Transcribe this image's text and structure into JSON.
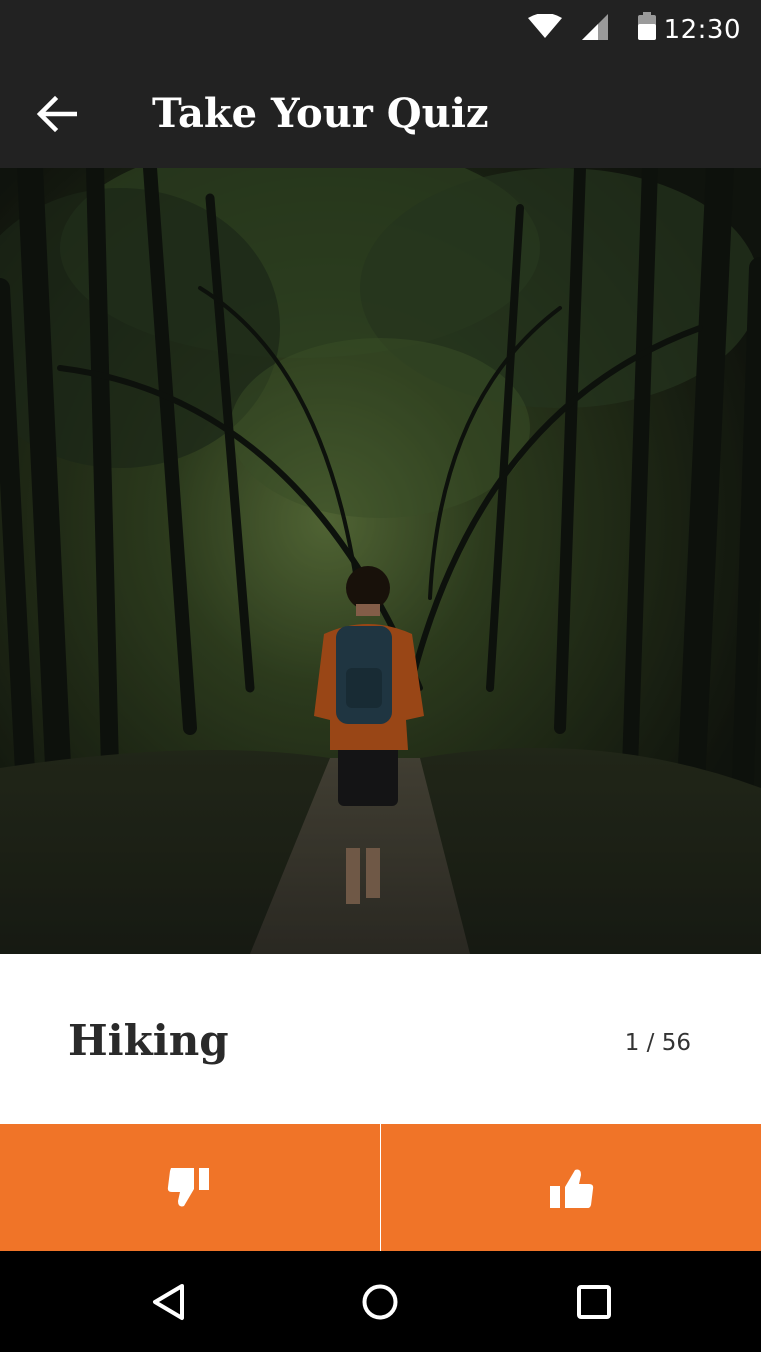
{
  "status_bar": {
    "time": "12:30",
    "icons": [
      "wifi-icon",
      "cell-signal-icon",
      "battery-icon"
    ]
  },
  "app_bar": {
    "title": "Take Your Quiz",
    "back_icon": "arrow-left-icon"
  },
  "card": {
    "topic": "Hiking",
    "progress": "1 / 56",
    "image_icon": "forest-hiker-photo"
  },
  "actions": {
    "dislike_icon": "thumbs-down-icon",
    "like_icon": "thumbs-up-icon"
  },
  "nav_bar": {
    "icons": [
      "back-triangle-icon",
      "home-circle-icon",
      "recents-square-icon"
    ]
  },
  "colors": {
    "bar_background": "#222222",
    "accent": "#f07428",
    "nav_background": "#000000"
  }
}
